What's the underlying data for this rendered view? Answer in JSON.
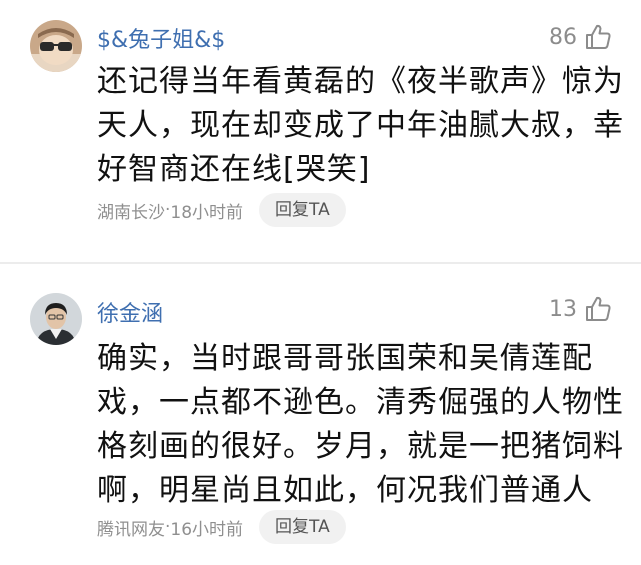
{
  "comments": [
    {
      "username": "$&兔子姐&$",
      "likes": "86",
      "lines": [
        "还记得当年看黄磊的《夜半歌声》惊为",
        "天人，现在却变成了中年油腻大叔，幸",
        "好智商还在线[哭笑]"
      ],
      "location": "湖南长沙",
      "time": "18小时前",
      "separator": " · ",
      "reply_label": "回复TA"
    },
    {
      "username": "徐金涵",
      "likes": "13",
      "lines": [
        "确实，当时跟哥哥张国荣和吴倩莲配",
        "戏，一点都不逊色。清秀倔强的人物性",
        "格刻画的很好。岁月，就是一把猪饲料",
        "啊，明星尚且如此，何况我们普通人"
      ],
      "location": "腾讯网友",
      "time": "16小时前",
      "separator": " · ",
      "reply_label": "回复TA"
    }
  ],
  "icons": {
    "like": "thumbs-up-icon",
    "avatar1": "sunglasses-avatar",
    "avatar2": "portrait-avatar"
  },
  "colors": {
    "username": "#3f6fb0",
    "meta": "#8f8f8f",
    "text": "#111111",
    "reply_bg": "#f1f1f1"
  }
}
